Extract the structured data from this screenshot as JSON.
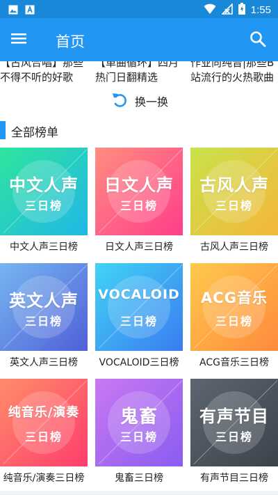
{
  "status_bar": {
    "time": "1:55",
    "icons": [
      "image-icon",
      "text-a-icon",
      "wifi-icon",
      "signal-icon",
      "battery-icon"
    ]
  },
  "app_bar": {
    "title": "首页",
    "menu_icon": "menu-icon",
    "search_icon": "search-icon",
    "color": "#2196f3"
  },
  "recommend": {
    "items": [
      {
        "title": "【古风合唱】那些不得不听的好歌"
      },
      {
        "title": "【单曲循环】四月热门日翻精选"
      },
      {
        "title": "作业向纯音|那些B站流行的火热歌曲"
      }
    ],
    "shuffle_label": "换一换"
  },
  "section": {
    "title": "全部榜单"
  },
  "charts": [
    {
      "cover_name": "中文人声",
      "cover_sub": "三日榜",
      "caption": "中文人声三日榜",
      "grad_from": "#2ee59d",
      "grad_to": "#21b7e8"
    },
    {
      "cover_name": "日文人声",
      "cover_sub": "三日榜",
      "caption": "日文人声三日榜",
      "grad_from": "#ff8e7f",
      "grad_to": "#ff3d8b"
    },
    {
      "cover_name": "古风人声",
      "cover_sub": "三日榜",
      "caption": "古风人声三日榜",
      "grad_from": "#c9e34a",
      "grad_to": "#f5b63a"
    },
    {
      "cover_name": "英文人声",
      "cover_sub": "三日榜",
      "caption": "英文人声三日榜",
      "grad_from": "#77b6f0",
      "grad_to": "#5060d8"
    },
    {
      "cover_name": "VOCALOID",
      "cover_sub": "三日榜",
      "caption": "VOCALOID三日榜",
      "grad_from": "#41d4f5",
      "grad_to": "#3a7cf0"
    },
    {
      "cover_name": "ACG音乐",
      "cover_sub": "三日榜",
      "caption": "ACG音乐三日榜",
      "grad_from": "#ffc94d",
      "grad_to": "#ff8a3d"
    },
    {
      "cover_name": "纯音乐/演奏",
      "cover_sub": "三日榜",
      "caption": "纯音乐/演奏三日榜",
      "grad_from": "#ff8c6b",
      "grad_to": "#ff3d6b"
    },
    {
      "cover_name": "鬼畜",
      "cover_sub": "三日榜",
      "caption": "鬼畜三日榜",
      "grad_from": "#c979f2",
      "grad_to": "#8a5cf0"
    },
    {
      "cover_name": "有声节目",
      "cover_sub": "三日榜",
      "caption": "有声节目三日榜",
      "grad_from": "#5d6670",
      "grad_to": "#3b434c"
    }
  ]
}
